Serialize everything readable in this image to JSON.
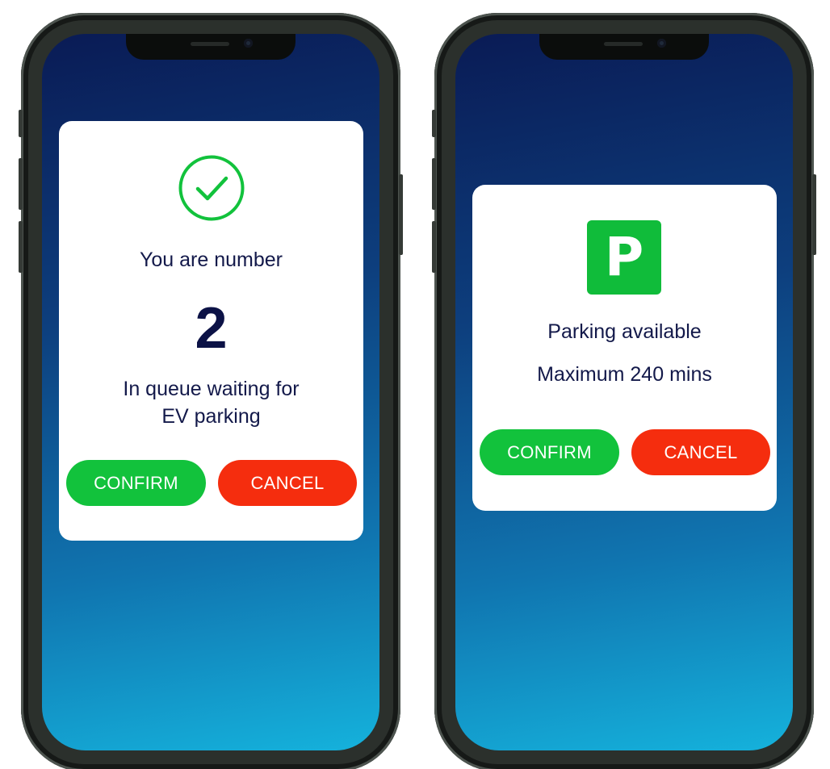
{
  "left_screen": {
    "queue_label": "You are number",
    "queue_number": "2",
    "queue_message_line1": "In queue waiting for",
    "queue_message_line2": "EV parking",
    "confirm_label": "CONFIRM",
    "cancel_label": "CANCEL"
  },
  "right_screen": {
    "parking_icon_letter": "P",
    "status_text": "Parking available",
    "limit_text": "Maximum 240 mins",
    "confirm_label": "CONFIRM",
    "cancel_label": "CANCEL"
  },
  "icons": {
    "check": "check-circle-icon",
    "parking": "parking-icon"
  },
  "colors": {
    "success_green": "#12c23c",
    "danger_red": "#f52d0e",
    "text_navy": "#13194a",
    "parking_green": "#10bc3a"
  }
}
